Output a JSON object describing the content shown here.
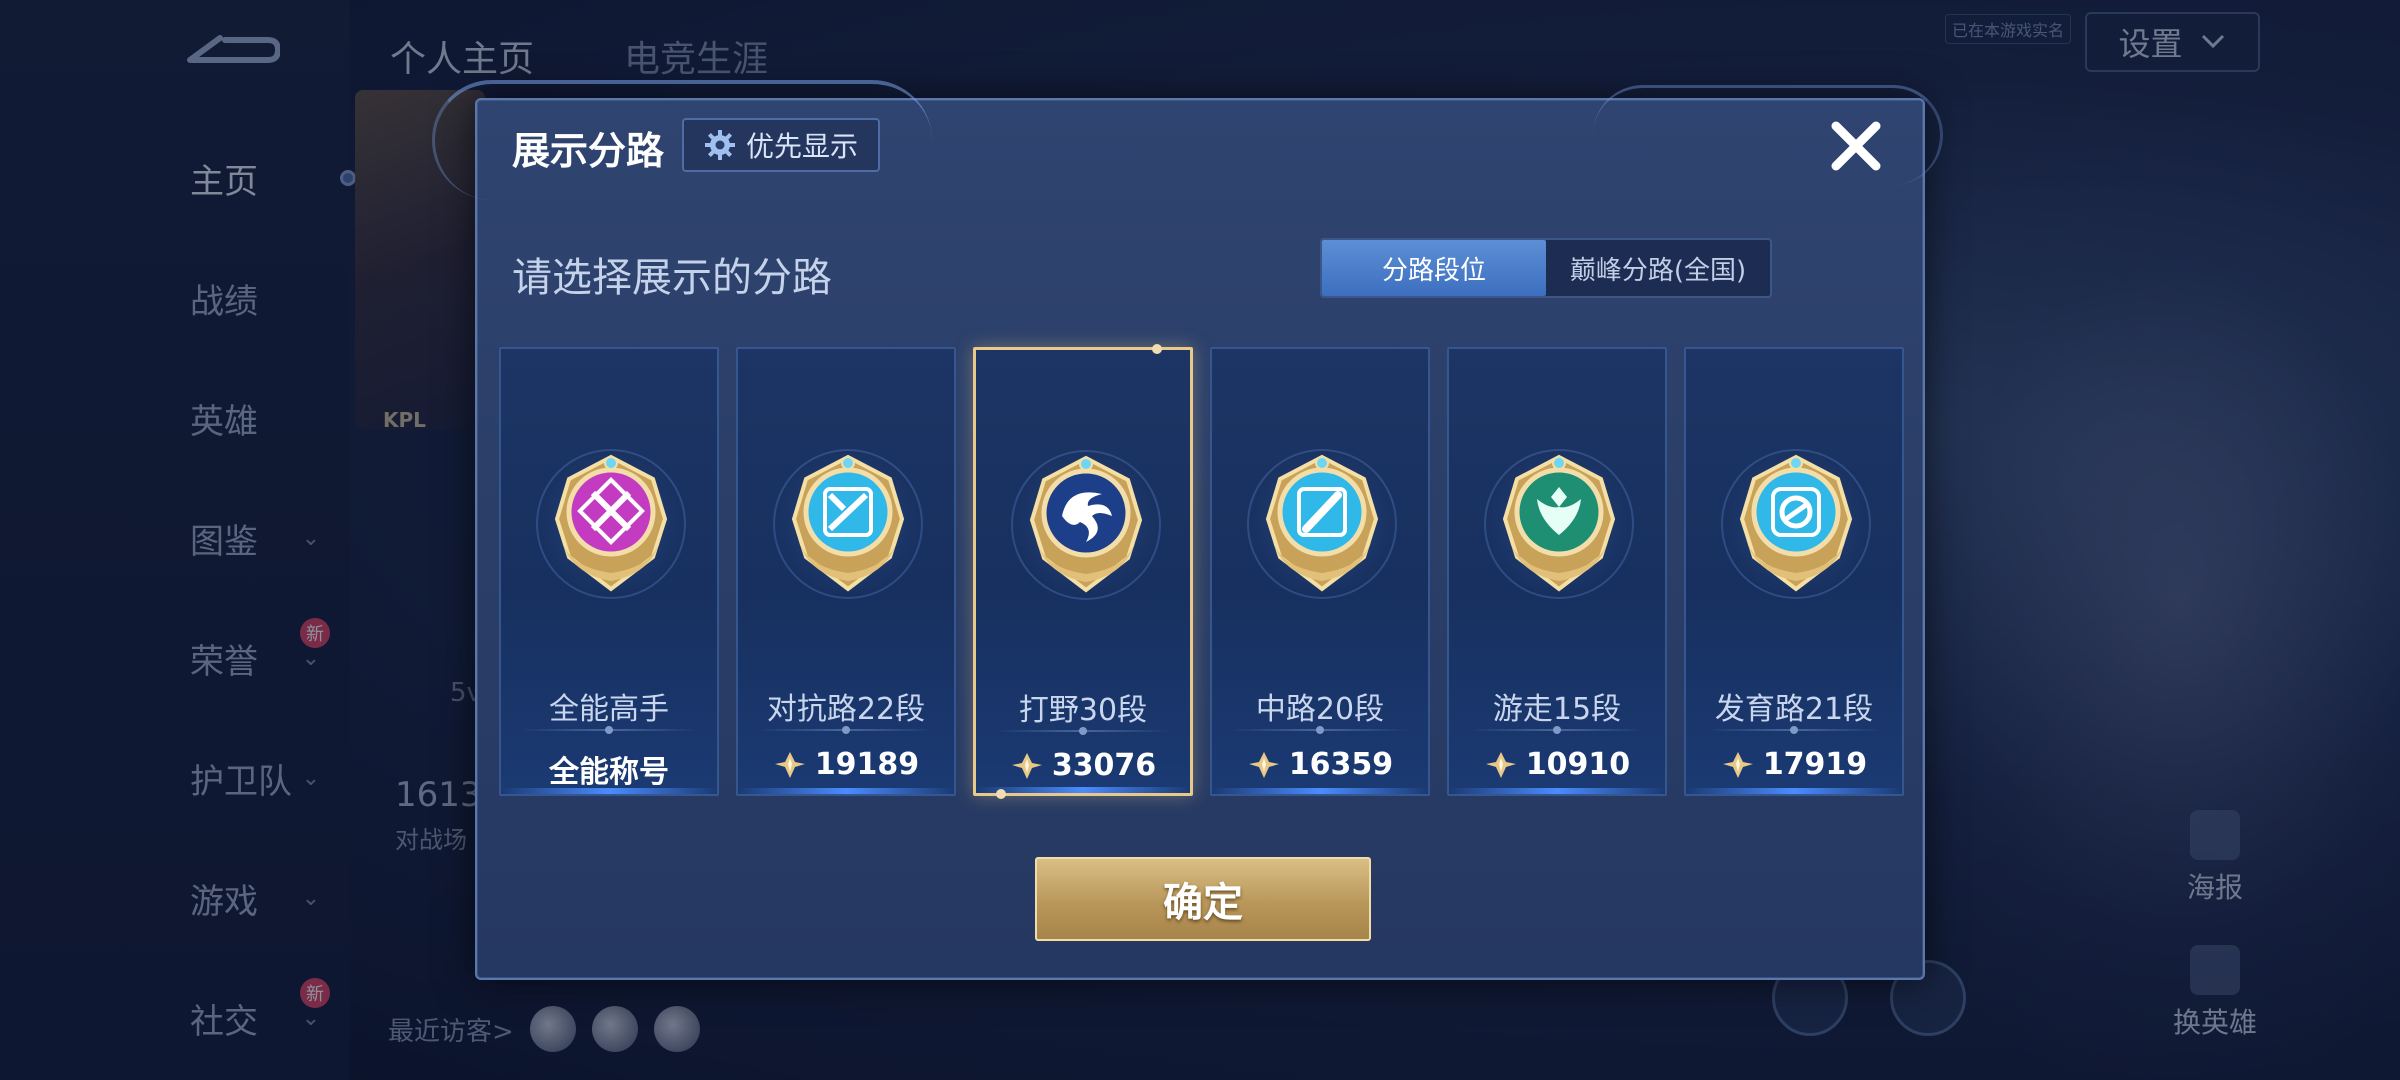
{
  "background": {
    "top_tabs": [
      "个人主页",
      "电竞生涯"
    ],
    "sidebar": [
      {
        "label": "主页",
        "active": true
      },
      {
        "label": "战绩"
      },
      {
        "label": "英雄"
      },
      {
        "label": "图鉴",
        "chevron": true
      },
      {
        "label": "荣誉",
        "chevron": true,
        "badge": "新"
      },
      {
        "label": "护卫队",
        "chevron": true
      },
      {
        "label": "游戏",
        "chevron": true
      },
      {
        "label": "社交",
        "chevron": true,
        "badge": "新"
      }
    ],
    "settings_label": "设置",
    "number_fragment": "1613",
    "number_sub": "对战场",
    "five_v": "5v",
    "recent_visitors": "最近访客>",
    "right_buttons": [
      "海报",
      "换英雄"
    ],
    "card_tag": "KPL"
  },
  "modal": {
    "title": "展示分路",
    "priority_label": "优先显示",
    "subtitle": "请选择展示的分路",
    "toggle": {
      "options": [
        "分路段位",
        "巅峰分路(全国)"
      ],
      "active_index": 0
    },
    "cards": [
      {
        "label": "全能高手",
        "score": "全能称号",
        "score_icon": false,
        "emblem": "all-round",
        "color": "#c23bc0"
      },
      {
        "label": "对抗路22段",
        "score": "19189",
        "score_icon": true,
        "emblem": "clash-lane",
        "color": "#2fb8e8"
      },
      {
        "label": "打野30段",
        "score": "33076",
        "score_icon": true,
        "emblem": "jungle",
        "color": "#1d3f8a",
        "selected": true
      },
      {
        "label": "中路20段",
        "score": "16359",
        "score_icon": true,
        "emblem": "mid-lane",
        "color": "#2fb8e8"
      },
      {
        "label": "游走15段",
        "score": "10910",
        "score_icon": true,
        "emblem": "roam",
        "color": "#1f8f74"
      },
      {
        "label": "发育路21段",
        "score": "17919",
        "score_icon": true,
        "emblem": "farm-lane",
        "color": "#2fb8e8"
      }
    ],
    "confirm_label": "确定"
  },
  "colors": {
    "accent_gold": "#e9c98a",
    "toggle_active": "#4a7cc9",
    "modal_bg": "#2c4169"
  }
}
